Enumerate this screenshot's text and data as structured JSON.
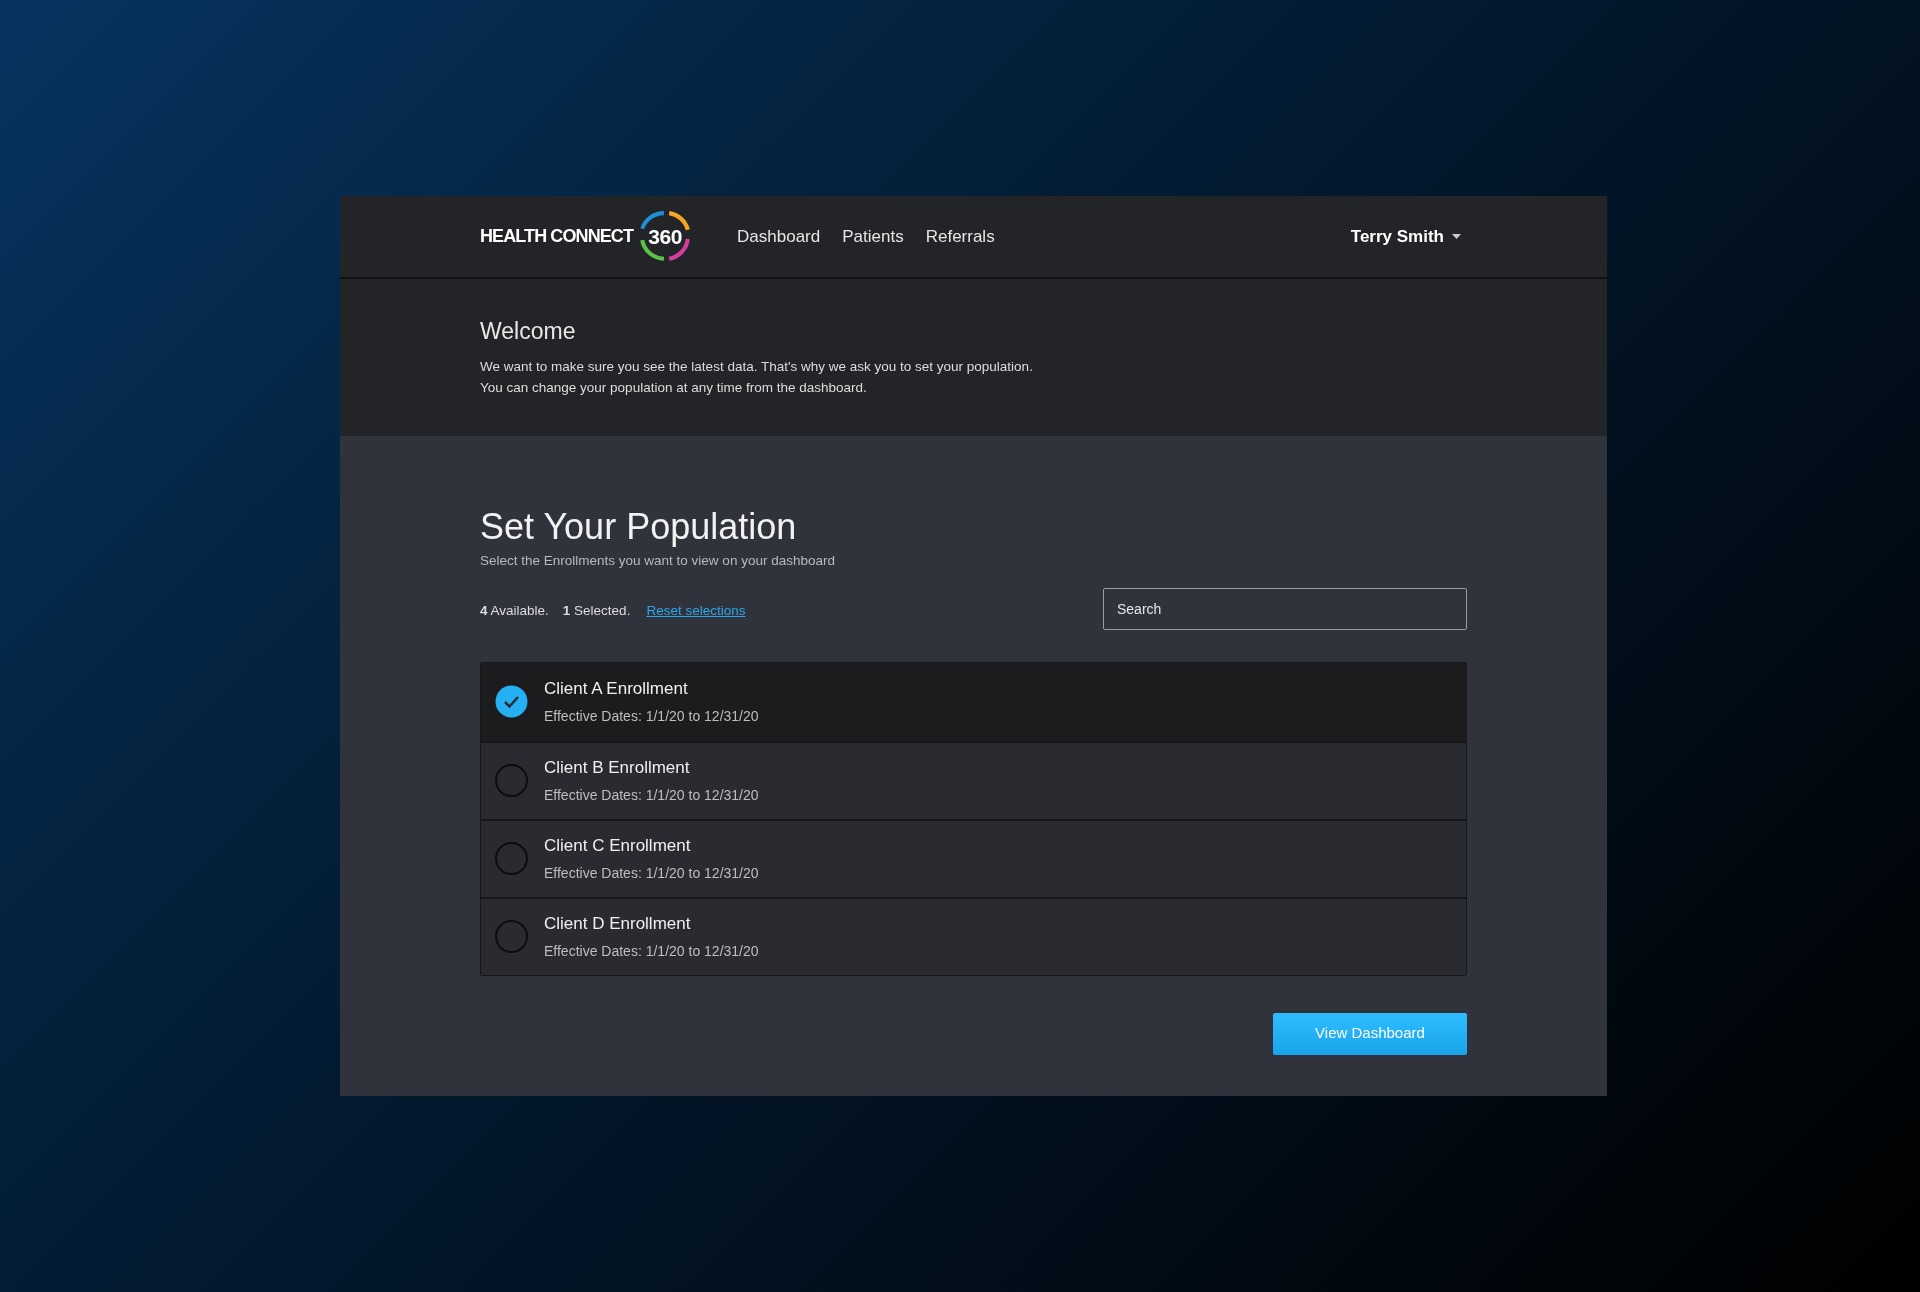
{
  "logo": {
    "wordmark": "HEALTH CONNECT",
    "badge": "360"
  },
  "nav": [
    {
      "label": "Dashboard"
    },
    {
      "label": "Patients"
    },
    {
      "label": "Referrals"
    }
  ],
  "user_menu": {
    "name": "Terry Smith"
  },
  "welcome": {
    "title": "Welcome",
    "lines": [
      "We want to make sure you see the latest data. That's why we ask you to set your population.",
      "You can change your population at any time from the dashboard."
    ]
  },
  "population": {
    "title": "Set Your Population",
    "subtitle": "Select the Enrollments you want to view on your dashboard",
    "available": "**4** Available.",
    "selected_count": "**1** Selected.",
    "reset_link": "Reset selections",
    "search": {
      "placeholder": "Search"
    }
  },
  "enrollments": [
    {
      "name": "Client A Enrollment",
      "dates": "Effective Dates: 1/1/20 to 12/31/20",
      "selected": true
    },
    {
      "name": "Client B Enrollment",
      "dates": "Effective Dates: 1/1/20 to 12/31/20",
      "selected": false
    },
    {
      "name": "Client C Enrollment",
      "dates": "Effective Dates: 1/1/20 to 12/31/20",
      "selected": false
    },
    {
      "name": "Client D Enrollment",
      "dates": "Effective Dates: 1/1/20 to 12/31/20",
      "selected": false
    }
  ],
  "primary_button": "View Dashboard"
}
